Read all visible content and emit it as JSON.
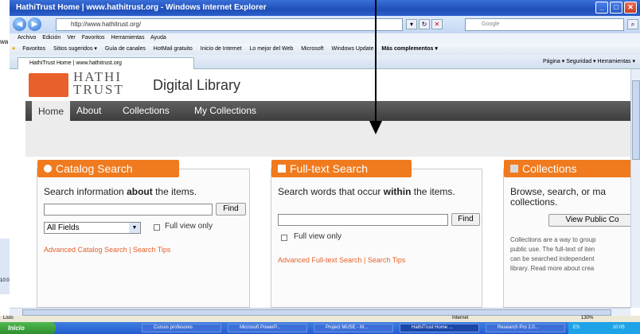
{
  "window": {
    "title": "HathiTrust Home | www.hathitrust.org - Windows Internet Explorer",
    "address": "http://www.hathitrust.org/",
    "search_placeholder": "Google",
    "left_clip": "wa",
    "left_clip_2": "10:0"
  },
  "menubar": [
    "Archivo",
    "Edición",
    "Ver",
    "Favoritos",
    "Herramientas",
    "Ayuda"
  ],
  "favorites": {
    "label": "Favoritos",
    "items": [
      "Sitios sugeridos ▾",
      "Guía de canales",
      "HotMail gratuito",
      "Inicio de Internet",
      "Lo mejor del Web",
      "Microsoft",
      "Windows Update",
      "Más complementos ▾"
    ]
  },
  "tab": {
    "title": "HathiTrust Home | www.hathitrust.org"
  },
  "commandbar": "Página ▾  Seguridad ▾  Herramientas ▾",
  "site": {
    "logo_line1": "HATHI",
    "logo_line2": "TRUST",
    "subtitle": "Digital Library",
    "nav": [
      "Home",
      "About",
      "Collections",
      "My Collections"
    ]
  },
  "catalog": {
    "tab": "Catalog Search",
    "heading_pre": "Search information ",
    "heading_bold": "about",
    "heading_post": " the items.",
    "find": "Find",
    "select_value": "All Fields",
    "fullview": "Full view only",
    "advanced": "Advanced Catalog Search | Search Tips"
  },
  "fulltext": {
    "tab": "Full-text Search",
    "heading_pre": "Search words that occur ",
    "heading_bold": "within",
    "heading_post": " the items.",
    "find": "Find",
    "fullview": "Full view only",
    "advanced": "Advanced Full-text Search | Search Tips"
  },
  "collections": {
    "tab": "Collections",
    "heading": "Browse, search, or ma collections.",
    "button": "View Public Co",
    "desc_lines": [
      "Collections are a way to group",
      "public use. The full-text of iten",
      "can be searched independent",
      "library. Read more about crea"
    ]
  },
  "status": {
    "left": "Listo",
    "zone": "Internet",
    "zoom": "130%"
  },
  "taskbar": {
    "start": "Inicio",
    "items": [
      "Cursos profesores",
      "Microsoft PowerP...",
      "Project MUSE - M...",
      "HathiTrust Home ...",
      "Research Pro 2.0..."
    ],
    "lang": "ES",
    "time": "10:05"
  }
}
